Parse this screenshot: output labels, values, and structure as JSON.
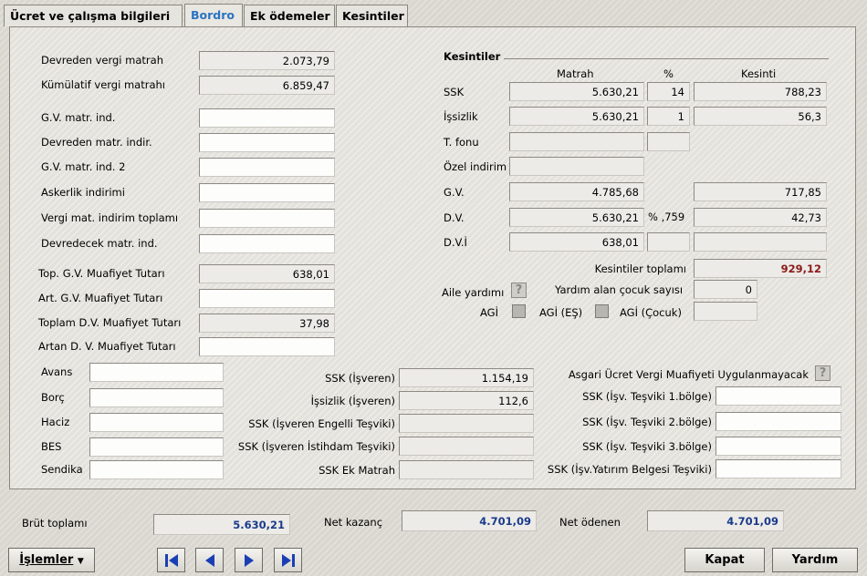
{
  "tabs": [
    "Ücret ve çalışma bilgileri",
    "Bordro",
    "Ek ödemeler",
    "Kesintiler"
  ],
  "left": {
    "rows": [
      {
        "label": "Devreden vergi matrah",
        "value": "2.073,79"
      },
      {
        "label": "Kümülatif vergi matrahı",
        "value": "6.859,47"
      },
      {
        "label": "G.V. matr. ind.",
        "value": ""
      },
      {
        "label": "Devreden matr. indir.",
        "value": ""
      },
      {
        "label": "G.V. matr. ind. 2",
        "value": ""
      },
      {
        "label": "Askerlik indirimi",
        "value": ""
      },
      {
        "label": "Vergi mat. indirim toplamı",
        "value": ""
      },
      {
        "label": "Devredecek matr. ind.",
        "value": ""
      },
      {
        "label": "Top. G.V. Muafiyet Tutarı",
        "value": "638,01"
      },
      {
        "label": "Art. G.V. Muafiyet Tutarı",
        "value": ""
      },
      {
        "label": "Toplam D.V. Muafiyet Tutarı",
        "value": "37,98"
      },
      {
        "label": "Artan D. V. Muafiyet Tutarı",
        "value": ""
      }
    ]
  },
  "kesintiler": {
    "title": "Kesintiler",
    "col_matrah": "Matrah",
    "col_pct": "%",
    "col_kesinti": "Kesinti",
    "rows": [
      {
        "label": "SSK",
        "matrah": "5.630,21",
        "pct": "14",
        "kesinti": "788,23"
      },
      {
        "label": "İşsizlik",
        "matrah": "5.630,21",
        "pct": "1",
        "kesinti": "56,3"
      },
      {
        "label": "T. fonu",
        "matrah": "",
        "pct": "",
        "kesinti": ""
      },
      {
        "label": "Özel indirim",
        "matrah": "",
        "pct": "",
        "kesinti": ""
      },
      {
        "label": "G.V.",
        "matrah": "4.785,68",
        "pct": "",
        "kesinti": "717,85"
      },
      {
        "label": "D.V.",
        "matrah": "5.630,21",
        "pct": "% ,759",
        "kesinti": "42,73"
      },
      {
        "label": "D.V.İ",
        "matrah": "638,01",
        "pct": "",
        "kesinti": ""
      }
    ],
    "total_label": "Kesintiler toplamı",
    "total_value": "929,12",
    "aile_yardimi": "Aile yardımı",
    "cocuk_label": "Yardım alan çocuk sayısı",
    "cocuk_value": "0",
    "agi": "AGİ",
    "agi_es": "AGİ (EŞ)",
    "agi_cocuk": "AGİ (Çocuk)",
    "agi_cocuk_value": ""
  },
  "misc": [
    {
      "label": "Avans",
      "value": ""
    },
    {
      "label": "Borç",
      "value": ""
    },
    {
      "label": "Haciz",
      "value": ""
    },
    {
      "label": "BES",
      "value": ""
    },
    {
      "label": "Sendika",
      "value": ""
    }
  ],
  "isveren": [
    {
      "label": "SSK (İşveren)",
      "value": "1.154,19"
    },
    {
      "label": "İşsizlik (İşveren)",
      "value": "112,6"
    },
    {
      "label": "SSK (İşveren Engelli Teşviki)",
      "value": ""
    },
    {
      "label": "SSK (İşveren İstihdam Teşviki)",
      "value": ""
    },
    {
      "label": "SSK Ek Matrah",
      "value": ""
    }
  ],
  "tesvik": {
    "asgari_label": "Asgari Ücret Vergi Muafiyeti Uygulanmayacak",
    "rows": [
      {
        "label": "SSK (İşv. Teşviki 1.bölge)",
        "value": ""
      },
      {
        "label": "SSK (İşv. Teşviki 2.bölge)",
        "value": ""
      },
      {
        "label": "SSK (İşv. Teşviki 3.bölge)",
        "value": ""
      },
      {
        "label": "SSK (İşv.Yatırım Belgesi Teşviki)",
        "value": ""
      }
    ]
  },
  "totals": {
    "brut_label": "Brüt toplamı",
    "brut_value": "5.630,21",
    "net_kazanc_label": "Net kazanç",
    "net_kazanc_value": "4.701,09",
    "net_odenen_label": "Net ödenen",
    "net_odenen_value": "4.701,09"
  },
  "buttons": {
    "islemler": "İşlemler",
    "kapat": "Kapat",
    "yardim": "Yardım"
  },
  "icons": [
    "first-record-icon",
    "prev-record-icon",
    "next-record-icon",
    "last-record-icon",
    "dropdown-arrow-icon",
    "help-check-icon"
  ],
  "colors": {
    "active_tab": "#2a74c2",
    "total_red": "#8c1a1a",
    "total_blue": "#1a3a8c"
  }
}
